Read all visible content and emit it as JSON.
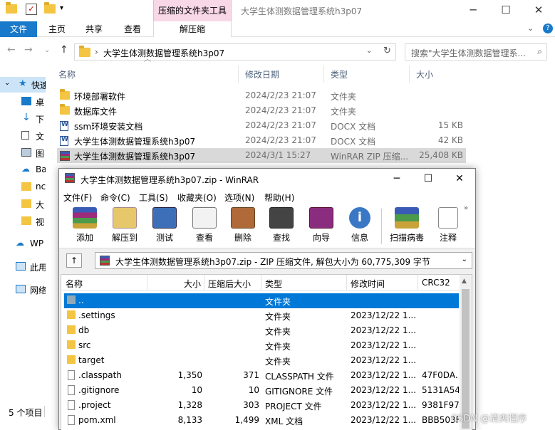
{
  "titlebar": {
    "context_tab": "压缩的文件夹工具",
    "title": "大学生体测数据管理系统h3p07",
    "minimize": "─",
    "maximize": "☐",
    "close": "✕"
  },
  "ribbon": {
    "tabs": [
      "文件",
      "主页",
      "共享",
      "查看"
    ],
    "context_tab": "解压缩"
  },
  "address": {
    "path": "大学生体测数据管理系统h3p07",
    "search_placeholder": "搜索\"大学生体测数据管理系..."
  },
  "sidebar": {
    "items": [
      "快速",
      "桌",
      "下",
      "文",
      "图",
      "Ba",
      "nc",
      "大",
      "视",
      "WP",
      "此用",
      "网络"
    ]
  },
  "explorer": {
    "headers": {
      "name": "名称",
      "date": "修改日期",
      "type": "类型",
      "size": "大小"
    },
    "rows": [
      {
        "name": "环境部署软件",
        "date": "2024/2/23 21:07",
        "type": "文件夹",
        "size": "",
        "icon": "folder-icon"
      },
      {
        "name": "数据库文件",
        "date": "2024/2/23 21:07",
        "type": "文件夹",
        "size": "",
        "icon": "folder-icon"
      },
      {
        "name": "ssm环境安装文档",
        "date": "2024/2/23 21:07",
        "type": "DOCX 文档",
        "size": "15 KB",
        "icon": "docx-icon"
      },
      {
        "name": "大学生体测数据管理系统h3p07",
        "date": "2024/2/23 21:07",
        "type": "DOCX 文档",
        "size": "42 KB",
        "icon": "docx-icon"
      },
      {
        "name": "大学生体测数据管理系统h3p07",
        "date": "2024/3/1 15:27",
        "type": "WinRAR ZIP 压缩...",
        "size": "25,408 KB",
        "icon": "winrar-icon"
      }
    ],
    "status": "5 个项目"
  },
  "winrar": {
    "title": "大学生体测数据管理系统h3p07.zip - WinRAR",
    "menu": [
      "文件(F)",
      "命令(C)",
      "工具(S)",
      "收藏夹(O)",
      "选项(N)",
      "帮助(H)"
    ],
    "toolbar": [
      "添加",
      "解压到",
      "测试",
      "查看",
      "删除",
      "查找",
      "向导",
      "信息",
      "扫描病毒",
      "注释"
    ],
    "path": "大学生体测数据管理系统h3p07.zip - ZIP 压缩文件, 解包大小为 60,775,309 字节",
    "columns": {
      "name": "名称",
      "size": "大小",
      "packed": "压缩后大小",
      "type": "类型",
      "modified": "修改时间",
      "crc": "CRC32"
    },
    "rows": [
      {
        "name": "..",
        "size": "",
        "packed": "",
        "type": "文件夹",
        "modified": "",
        "crc": ""
      },
      {
        "name": ".settings",
        "size": "",
        "packed": "",
        "type": "文件夹",
        "modified": "2023/12/22 1...",
        "crc": ""
      },
      {
        "name": "db",
        "size": "",
        "packed": "",
        "type": "文件夹",
        "modified": "2023/12/22 1...",
        "crc": ""
      },
      {
        "name": "src",
        "size": "",
        "packed": "",
        "type": "文件夹",
        "modified": "2023/12/22 1...",
        "crc": ""
      },
      {
        "name": "target",
        "size": "",
        "packed": "",
        "type": "文件夹",
        "modified": "2023/12/22 1...",
        "crc": ""
      },
      {
        "name": ".classpath",
        "size": "1,350",
        "packed": "371",
        "type": "CLASSPATH 文件",
        "modified": "2023/12/22 1...",
        "crc": "47F0DA..."
      },
      {
        "name": ".gitignore",
        "size": "10",
        "packed": "10",
        "type": "GITIGNORE 文件",
        "modified": "2023/12/22 1...",
        "crc": "5131A54..."
      },
      {
        "name": ".project",
        "size": "1,328",
        "packed": "303",
        "type": "PROJECT 文件",
        "modified": "2023/12/22 1...",
        "crc": "9381F978"
      },
      {
        "name": "pom.xml",
        "size": "8,133",
        "packed": "1,499",
        "type": "XML 文档",
        "modified": "2023/12/22 1...",
        "crc": "BBB503F..."
      }
    ]
  },
  "watermark": "CSDN @清爽程序"
}
